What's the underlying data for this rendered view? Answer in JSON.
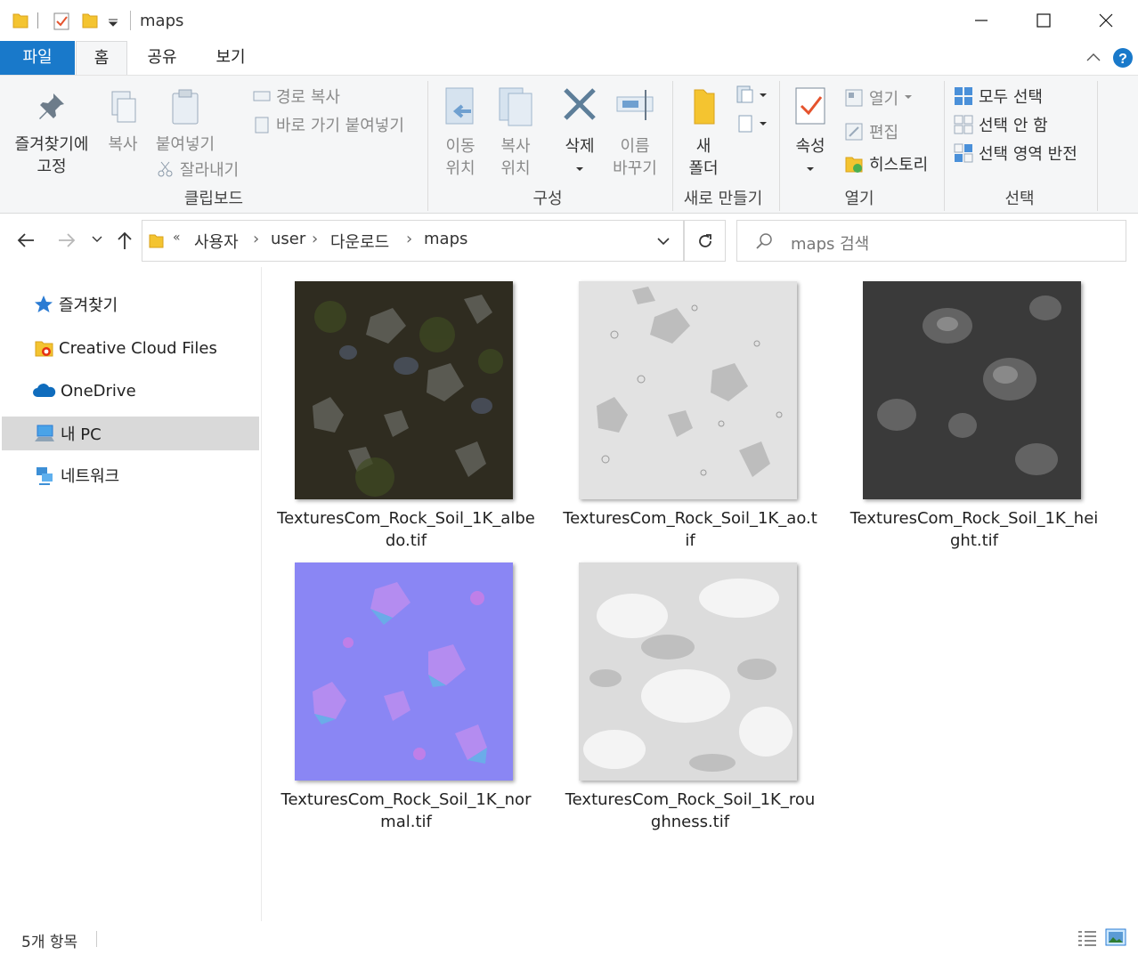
{
  "window": {
    "title": "maps"
  },
  "tabs": [
    {
      "label": "파일"
    },
    {
      "label": "홈"
    },
    {
      "label": "공유"
    },
    {
      "label": "보기"
    }
  ],
  "ribbon": {
    "clipboard": {
      "pin_label_1": "즐겨찾기에",
      "pin_label_2": "고정",
      "copy_label": "복사",
      "paste_label": "붙여넣기",
      "copy_path_label": "경로 복사",
      "paste_shortcut_label": "바로 가기 붙여넣기",
      "cut_label": "잘라내기",
      "group_label": "클립보드"
    },
    "organize": {
      "move_label_1": "이동",
      "move_label_2": "위치",
      "copyto_label_1": "복사",
      "copyto_label_2": "위치",
      "delete_label": "삭제",
      "rename_label_1": "이름",
      "rename_label_2": "바꾸기",
      "group_label": "구성"
    },
    "new": {
      "folder_label_1": "새",
      "folder_label_2": "폴더",
      "group_label": "새로 만들기"
    },
    "open": {
      "props_label": "속성",
      "open_label": "열기",
      "edit_label": "편집",
      "history_label": "히스토리",
      "group_label": "열기"
    },
    "select": {
      "all_label": "모두 선택",
      "none_label": "선택 안 함",
      "invert_label": "선택 영역 반전",
      "group_label": "선택"
    }
  },
  "address": {
    "prefix": "«",
    "crumbs": [
      "사용자",
      "user",
      "다운로드",
      "maps"
    ]
  },
  "search": {
    "placeholder": "maps 검색"
  },
  "sidebar": {
    "items": [
      {
        "label": "즐겨찾기"
      },
      {
        "label": "Creative Cloud Files"
      },
      {
        "label": "OneDrive"
      },
      {
        "label": "내 PC"
      },
      {
        "label": "네트워크"
      }
    ]
  },
  "files": [
    {
      "name": "TexturesCom_Rock_Soil_1K_albedo.tif"
    },
    {
      "name": "TexturesCom_Rock_Soil_1K_ao.tif"
    },
    {
      "name": "TexturesCom_Rock_Soil_1K_height.tif"
    },
    {
      "name": "TexturesCom_Rock_Soil_1K_normal.tif"
    },
    {
      "name": "TexturesCom_Rock_Soil_1K_roughness.tif"
    }
  ],
  "status": {
    "count": "5개 항목"
  },
  "colors": {
    "accent": "#1979ca",
    "selection": "#d9d9d9",
    "folder": "#f4c430"
  }
}
